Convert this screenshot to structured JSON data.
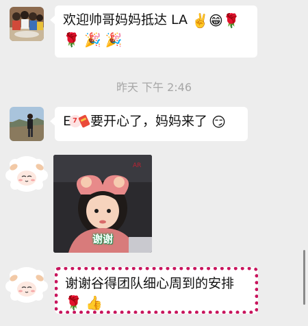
{
  "messages": [
    {
      "sender": "group-member-family",
      "text": "欢迎帅哥妈妈抵达 LA",
      "emojis_line1": [
        "✌️",
        "😁",
        "🌹"
      ],
      "emojis_line2": [
        "🌹",
        "🎉",
        "🎉"
      ]
    },
    {
      "timestamp": "昨天 下午 2:46"
    },
    {
      "sender": "group-member-outdoor",
      "text_prefix": "E",
      "text": "要开心了，妈妈来了",
      "emojis": [
        "😏"
      ]
    },
    {
      "sender": "sheep-avatar",
      "sticker_caption": "谢谢"
    },
    {
      "sender": "sheep-avatar",
      "text": "谢谢谷得团队细心周到的安排",
      "emojis": [
        "🌹",
        "👍"
      ]
    }
  ]
}
